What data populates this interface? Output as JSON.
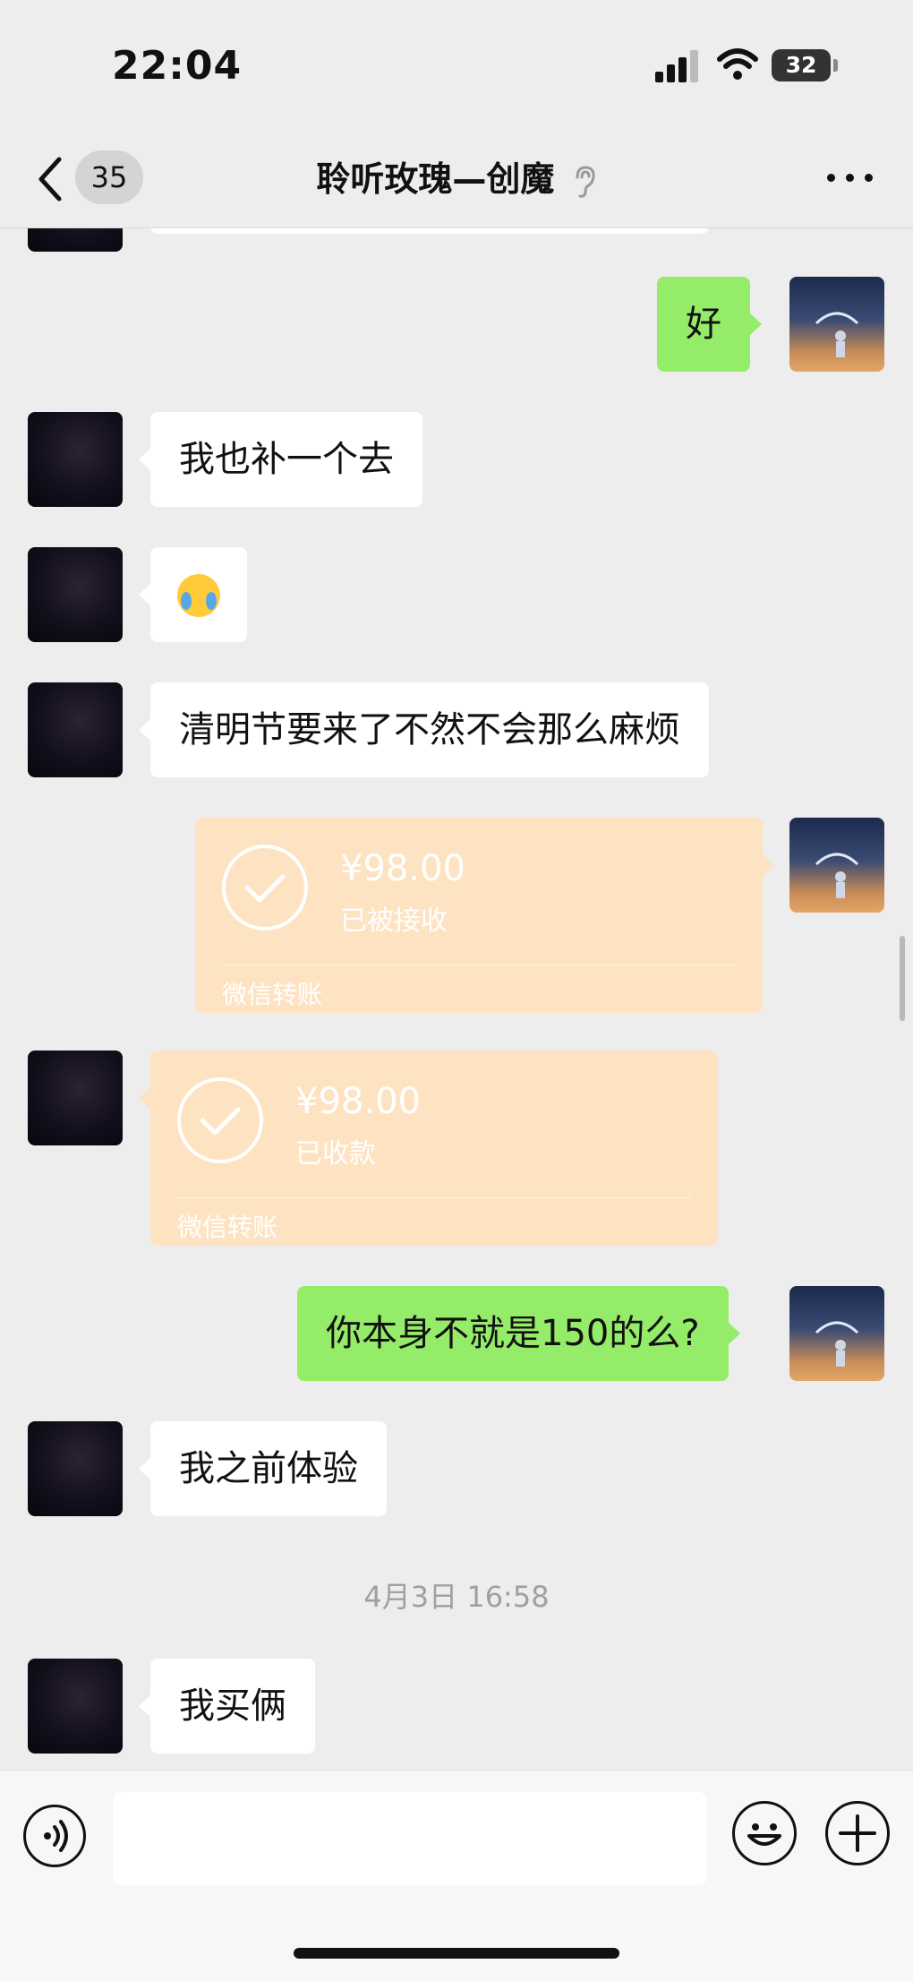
{
  "status_bar": {
    "time": "22:04",
    "battery": "32"
  },
  "header": {
    "back_count": "35",
    "title": "聆听玫瑰—创魔"
  },
  "messages": {
    "m1": "好",
    "m2": "我也补一个去",
    "m4": "清明节要来了不然不会那么麻烦",
    "m5": {
      "amount": "¥98.00",
      "status": "已被接收",
      "label": "微信转账"
    },
    "m6": {
      "amount": "¥98.00",
      "status": "已收款",
      "label": "微信转账"
    },
    "m7": "你本身不就是150的么?",
    "m8": "我之前体验",
    "timestamp": "4月3日 16:58",
    "m9": "我买俩"
  },
  "input": {
    "value": ""
  },
  "colors": {
    "self_bubble": "#95ec69",
    "other_bubble": "#ffffff",
    "transfer_bubble": "#fde3c2",
    "background": "#ededed"
  },
  "icons": [
    "back-chevron-icon",
    "ear-icon",
    "more-dots-icon",
    "voice-icon",
    "emoji-icon",
    "plus-icon",
    "cellular-signal-icon",
    "wifi-icon",
    "battery-icon"
  ]
}
